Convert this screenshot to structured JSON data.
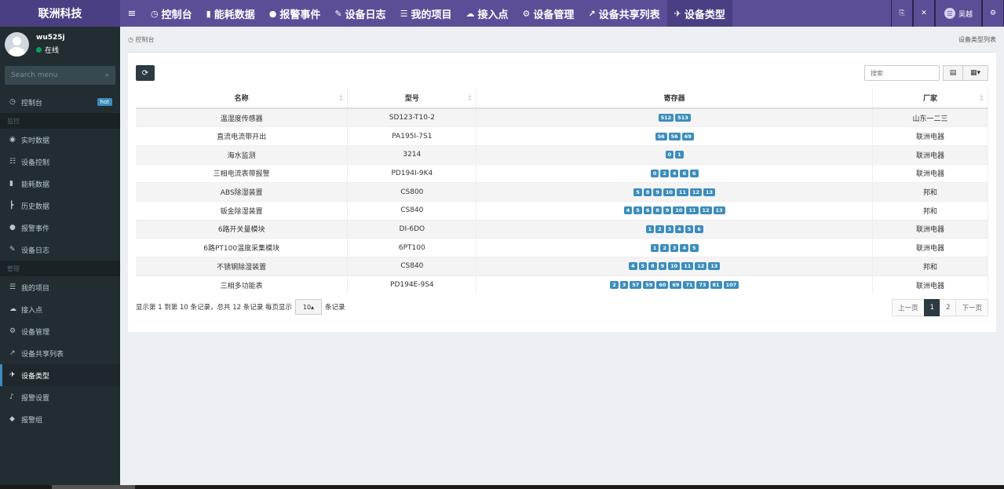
{
  "app": {
    "logo": "联洲科技"
  },
  "nav": {
    "toggle": "≡",
    "items": [
      {
        "label": "控制台",
        "icon": "dashboard-icon",
        "glyph": "◷"
      },
      {
        "label": "能耗数据",
        "icon": "bar-chart-icon",
        "glyph": "▮"
      },
      {
        "label": "报警事件",
        "icon": "exclamation-circle-icon",
        "glyph": "●"
      },
      {
        "label": "设备日志",
        "icon": "edit-icon",
        "glyph": "✎"
      },
      {
        "label": "我的项目",
        "icon": "list-icon",
        "glyph": "☰"
      },
      {
        "label": "接入点",
        "icon": "cloud-upload-icon",
        "glyph": "☁"
      },
      {
        "label": "设备管理",
        "icon": "cogs-icon",
        "glyph": "⚙"
      },
      {
        "label": "设备共享列表",
        "icon": "share-icon",
        "glyph": "↗"
      },
      {
        "label": "设备类型",
        "icon": "plane-icon",
        "glyph": "✈"
      }
    ],
    "active_index": 8
  },
  "topright": {
    "user": "吴越"
  },
  "sidebar": {
    "username": "wu525j",
    "status": "在线",
    "search_placeholder": "Search menu",
    "dashboard": {
      "label": "控制台",
      "badge": "hot"
    },
    "section_monitor": "监控",
    "monitor_items": [
      {
        "label": "实时数据",
        "icon": "eye-icon",
        "glyph": "◉"
      },
      {
        "label": "设备控制",
        "icon": "sliders-icon",
        "glyph": "☷"
      },
      {
        "label": "能耗数据",
        "icon": "bar-chart-icon",
        "glyph": "▮"
      },
      {
        "label": "历史数据",
        "icon": "history-chart-icon",
        "glyph": "┣"
      },
      {
        "label": "报警事件",
        "icon": "exclamation-circle-icon",
        "glyph": "●"
      },
      {
        "label": "设备日志",
        "icon": "edit-icon",
        "glyph": "✎"
      }
    ],
    "section_manage": "管理",
    "manage_items": [
      {
        "label": "我的项目",
        "icon": "list-icon",
        "glyph": "☰"
      },
      {
        "label": "接入点",
        "icon": "cloud-upload-icon",
        "glyph": "☁"
      },
      {
        "label": "设备管理",
        "icon": "cogs-icon",
        "glyph": "⚙"
      },
      {
        "label": "设备共享列表",
        "icon": "share-icon",
        "glyph": "↗"
      },
      {
        "label": "设备类型",
        "icon": "plane-icon",
        "glyph": "✈",
        "current": true
      },
      {
        "label": "报警设置",
        "icon": "bell-icon",
        "glyph": "♪"
      },
      {
        "label": "报警组",
        "icon": "tag-icon",
        "glyph": "◆"
      }
    ]
  },
  "content": {
    "breadcrumb": "控制台",
    "page_title": "设备类型列表",
    "search_placeholder": "搜索",
    "columns": [
      "名称",
      "型号",
      "寄存器",
      "厂家"
    ],
    "rows": [
      {
        "name": "温湿度传感器",
        "model": "SD123-T10-2",
        "registers": [
          "512",
          "513"
        ],
        "vendor": "山东一二三"
      },
      {
        "name": "直流电流带开出",
        "model": "PA195I-7S1",
        "registers": [
          "56",
          "56",
          "69"
        ],
        "vendor": "联洲电器"
      },
      {
        "name": "海水监测",
        "model": "3214",
        "registers": [
          "0",
          "1"
        ],
        "vendor": "联洲电器"
      },
      {
        "name": "三相电流表带报警",
        "model": "PD194I-9K4",
        "registers": [
          "0",
          "2",
          "4",
          "6",
          "6"
        ],
        "vendor": "联洲电器"
      },
      {
        "name": "ABS除湿装置",
        "model": "CS800",
        "registers": [
          "5",
          "8",
          "9",
          "10",
          "11",
          "12",
          "13"
        ],
        "vendor": "邦和"
      },
      {
        "name": "钣金除湿装置",
        "model": "CS840",
        "registers": [
          "4",
          "5",
          "6",
          "8",
          "9",
          "10",
          "11",
          "12",
          "13"
        ],
        "vendor": "邦和"
      },
      {
        "name": "6路开关量模块",
        "model": "DI-6DO",
        "registers": [
          "1",
          "2",
          "3",
          "4",
          "5",
          "6"
        ],
        "vendor": "联洲电器"
      },
      {
        "name": "6路PT100温度采集模块",
        "model": "6PT100",
        "registers": [
          "1",
          "2",
          "3",
          "4",
          "5"
        ],
        "vendor": "联洲电器"
      },
      {
        "name": "不锈钢除湿装置",
        "model": "CS840",
        "registers": [
          "4",
          "5",
          "8",
          "9",
          "10",
          "11",
          "12",
          "13"
        ],
        "vendor": "邦和"
      },
      {
        "name": "三相多功能表",
        "model": "PD194E-9S4",
        "registers": [
          "2",
          "3",
          "57",
          "59",
          "60",
          "69",
          "71",
          "73",
          "81",
          "107"
        ],
        "vendor": "联洲电器"
      }
    ],
    "pager": {
      "info_prefix": "显示第 1 到第 10 条记录，总共 12 条记录 每页显示",
      "page_size": "10",
      "info_suffix": "条记录",
      "prev": "上一页",
      "pages": [
        "1",
        "2"
      ],
      "active_page": "1",
      "next": "下一页"
    }
  }
}
